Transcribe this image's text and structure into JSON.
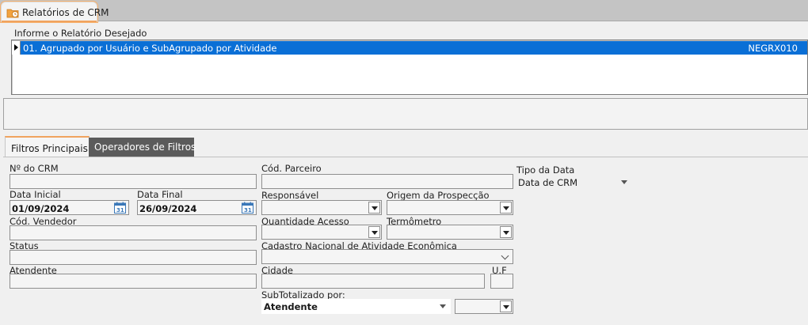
{
  "window": {
    "tab_title": "Relatórios de CRM"
  },
  "report_section": {
    "label": "Informe o Relatório Desejado",
    "items": [
      {
        "name": "01. Agrupado por Usuário e SubAgrupado por Atividade",
        "code": "NEGRX010"
      }
    ]
  },
  "tabs": [
    {
      "label": "Filtros Principais"
    },
    {
      "label": "Operadores de Filtros"
    }
  ],
  "filters": {
    "crm_number": {
      "label": "Nº do CRM",
      "value": ""
    },
    "partner_code": {
      "label": "Cód. Parceiro",
      "value": ""
    },
    "date_type": {
      "label": "Tipo da Data",
      "value": "Data de CRM"
    },
    "start_date": {
      "label": "Data Inicial",
      "value": "01/09/2024"
    },
    "end_date": {
      "label": "Data Final",
      "value": "26/09/2024"
    },
    "responsible": {
      "label": "Responsável",
      "value": ""
    },
    "prospect_origin": {
      "label": "Origem da Prospecção",
      "value": ""
    },
    "seller_code": {
      "label": "Cód. Vendedor",
      "value": ""
    },
    "access_quantity": {
      "label": "Quantidade Acesso",
      "value": ""
    },
    "thermometer": {
      "label": "Termômetro",
      "value": ""
    },
    "status": {
      "label": "Status",
      "value": ""
    },
    "cnae": {
      "label": "Cadastro Nacional de Atividade Econômica",
      "value": ""
    },
    "attendant": {
      "label": "Atendente",
      "value": ""
    },
    "city": {
      "label": "Cidade",
      "value": ""
    },
    "uf": {
      "label": "U.F",
      "value": ""
    },
    "subtotal_by": {
      "label": "SubTotalizado por:",
      "value": "Atendente",
      "secondary_value": ""
    }
  },
  "icons": {
    "tab_icon": "report-folder-clock-icon",
    "calendar": "calendar-icon"
  },
  "colors": {
    "selection": "#0a6fd6",
    "tab_accent": "#f0a35e",
    "inactive_tab": "#5b5b5b"
  }
}
